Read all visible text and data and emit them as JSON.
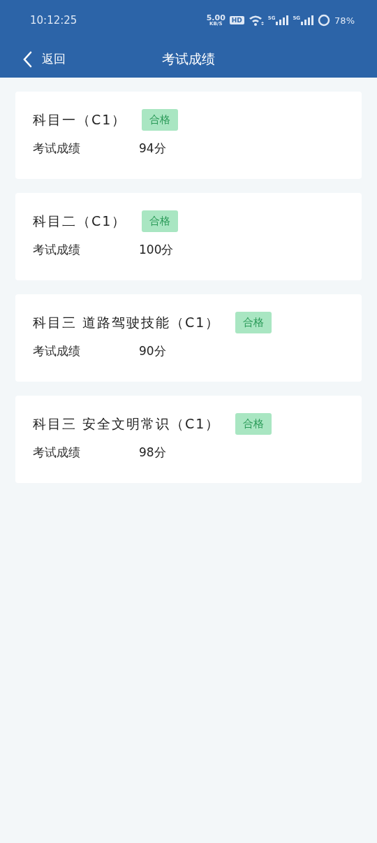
{
  "status_bar": {
    "time": "10:12:25",
    "net_speed": "5.00",
    "net_unit": "KB/S",
    "hd_label": "HD",
    "sim_labels": [
      "5G",
      "5G"
    ],
    "battery": "78%"
  },
  "header": {
    "back_label": "返回",
    "title": "考试成绩"
  },
  "results": [
    {
      "subject": "科目一（C1）",
      "status": {
        "kind": "pass",
        "label": "合格"
      },
      "score_label": "考试成绩",
      "score": "94分"
    },
    {
      "subject": "科目二（C1）",
      "status": {
        "kind": "pass",
        "label": "合格"
      },
      "score_label": "考试成绩",
      "score": "100分"
    },
    {
      "subject": "科目三 道路驾驶技能（C1）",
      "status": {
        "kind": "pass",
        "label": "合格"
      },
      "score_label": "考试成绩",
      "score": "90分"
    },
    {
      "subject": "科目三 安全文明常识（C1）",
      "status": {
        "kind": "pass",
        "label": "合格"
      },
      "score_label": "考试成绩",
      "score": "98分"
    }
  ]
}
